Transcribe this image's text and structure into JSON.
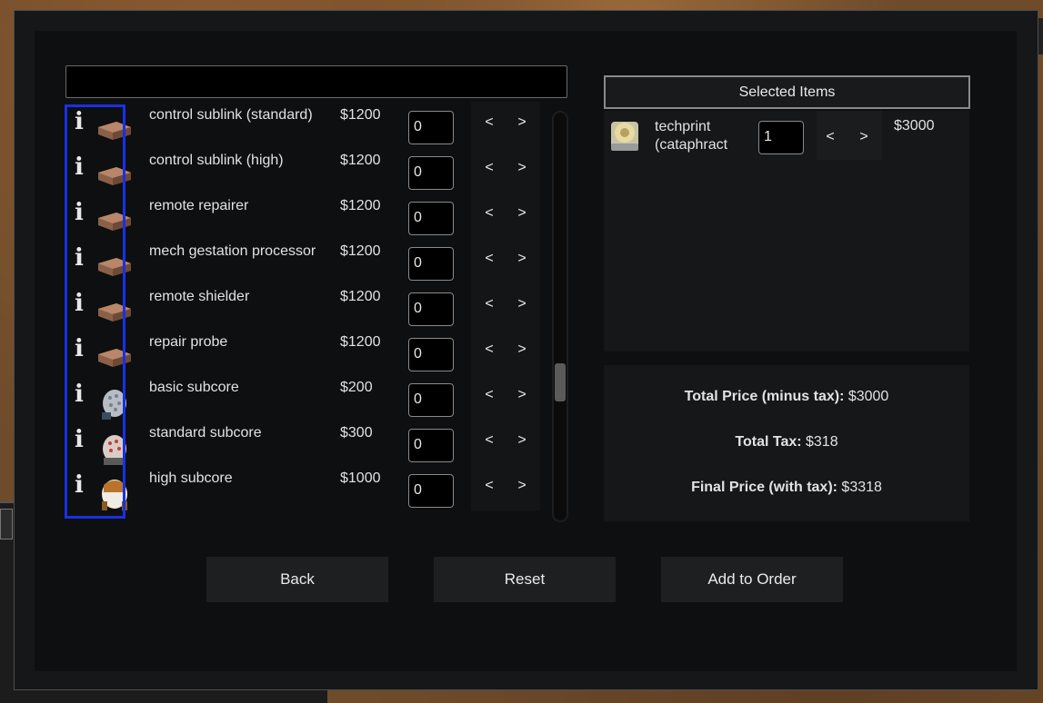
{
  "colors": {
    "dialog_bg": "#151719",
    "inner_bg": "#0e0f10",
    "highlight": "#1830e8",
    "button_bg": "#1e1f20"
  },
  "search": {
    "value": ""
  },
  "items": [
    {
      "name": "control sublink (standard)",
      "price": "$1200",
      "qty": "0",
      "icon": "box-icon"
    },
    {
      "name": "control sublink (high)",
      "price": "$1200",
      "qty": "0",
      "icon": "box-icon"
    },
    {
      "name": "remote repairer",
      "price": "$1200",
      "qty": "0",
      "icon": "box-icon"
    },
    {
      "name": "mech gestation processor",
      "price": "$1200",
      "qty": "0",
      "icon": "box-icon"
    },
    {
      "name": "remote shielder",
      "price": "$1200",
      "qty": "0",
      "icon": "box-icon"
    },
    {
      "name": "repair probe",
      "price": "$1200",
      "qty": "0",
      "icon": "box-icon"
    },
    {
      "name": "basic subcore",
      "price": "$200",
      "qty": "0",
      "icon": "subcore-basic-icon"
    },
    {
      "name": "standard subcore",
      "price": "$300",
      "qty": "0",
      "icon": "subcore-standard-icon"
    },
    {
      "name": "high subcore",
      "price": "$1000",
      "qty": "0",
      "icon": "subcore-high-icon"
    }
  ],
  "arrows": {
    "left": "<",
    "right": ">"
  },
  "info_glyph": "i",
  "selected": {
    "header": "Selected Items",
    "items": [
      {
        "name": "techprint (cataphract",
        "qty": "1",
        "price": "$3000",
        "icon": "techprint-icon"
      }
    ]
  },
  "totals": {
    "minus_tax_label": "Total Price (minus tax):",
    "minus_tax_value": " $3000",
    "tax_label": "Total Tax:",
    "tax_value": " $318",
    "final_label": "Final Price (with tax):",
    "final_value": " $3318"
  },
  "buttons": {
    "back": "Back",
    "reset": "Reset",
    "add": "Add to Order"
  }
}
